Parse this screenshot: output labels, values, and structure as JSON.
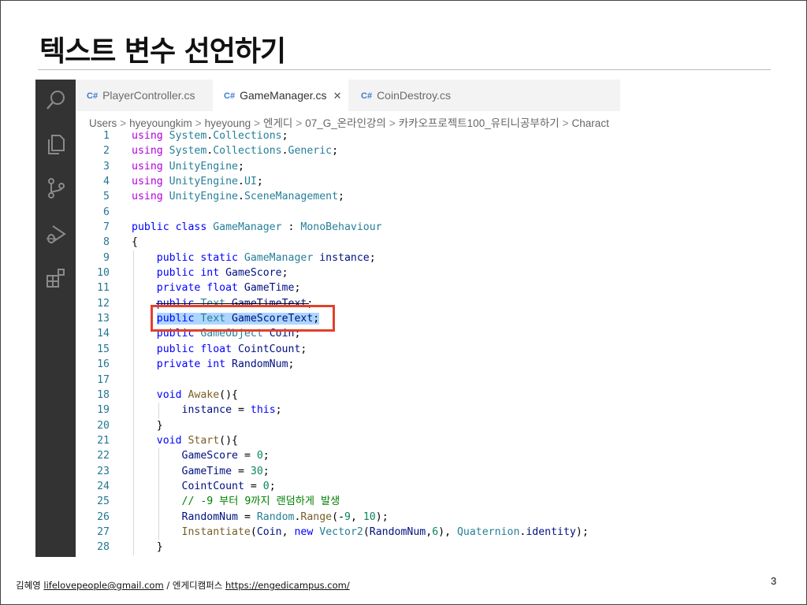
{
  "slide": {
    "title": "텍스트 변수 선언하기",
    "page_number": "3"
  },
  "footer": {
    "author": "김혜영",
    "email": "lifelovepeople@gmail.com",
    "separator": "/",
    "org": "엔게디캠퍼스",
    "url": "https://engedicampus.com/"
  },
  "activity_bar": {
    "icons": [
      "search-icon",
      "files-icon",
      "source-control-icon",
      "run-debug-icon",
      "extensions-icon"
    ]
  },
  "tabs": [
    {
      "icon": "C#",
      "label": "PlayerController.cs",
      "active": false
    },
    {
      "icon": "C#",
      "label": "GameManager.cs",
      "active": true,
      "close": "✕"
    },
    {
      "icon": "C#",
      "label": "CoinDestroy.cs",
      "active": false
    }
  ],
  "breadcrumb": [
    "Users",
    "hyeyoungkim",
    "hyeyoung",
    "엔게디",
    "07_G_온라인강의",
    "카카오프로젝트100_유티니공부하기",
    "Charact"
  ],
  "breadcrumb_sep": ">",
  "code_lines": [
    [
      [
        "kwp",
        "using "
      ],
      [
        "ty",
        "System"
      ],
      [
        "pn",
        "."
      ],
      [
        "ty",
        "Collections"
      ],
      [
        "pn",
        ";"
      ]
    ],
    [
      [
        "kwp",
        "using "
      ],
      [
        "ty",
        "System"
      ],
      [
        "pn",
        "."
      ],
      [
        "ty",
        "Collections"
      ],
      [
        "pn",
        "."
      ],
      [
        "ty",
        "Generic"
      ],
      [
        "pn",
        ";"
      ]
    ],
    [
      [
        "kwp",
        "using "
      ],
      [
        "ty",
        "UnityEngine"
      ],
      [
        "pn",
        ";"
      ]
    ],
    [
      [
        "kwp",
        "using "
      ],
      [
        "ty",
        "UnityEngine"
      ],
      [
        "pn",
        "."
      ],
      [
        "ty",
        "UI"
      ],
      [
        "pn",
        ";"
      ]
    ],
    [
      [
        "kwp",
        "using "
      ],
      [
        "ty",
        "UnityEngine"
      ],
      [
        "pn",
        "."
      ],
      [
        "ty",
        "SceneManagement"
      ],
      [
        "pn",
        ";"
      ]
    ],
    [],
    [
      [
        "kw",
        "public class "
      ],
      [
        "ty",
        "GameManager"
      ],
      [
        "pn",
        " : "
      ],
      [
        "ty",
        "MonoBehaviour"
      ]
    ],
    [
      [
        "pn",
        "{"
      ]
    ],
    [
      [
        "pn",
        "    "
      ],
      [
        "kw",
        "public static "
      ],
      [
        "ty",
        "GameManager "
      ],
      [
        "id",
        "instance"
      ],
      [
        "pn",
        ";"
      ]
    ],
    [
      [
        "pn",
        "    "
      ],
      [
        "kw",
        "public int "
      ],
      [
        "id",
        "GameScore"
      ],
      [
        "pn",
        ";"
      ]
    ],
    [
      [
        "pn",
        "    "
      ],
      [
        "kw",
        "private float "
      ],
      [
        "id",
        "GameTime"
      ],
      [
        "pn",
        ";"
      ]
    ],
    [
      [
        "pn",
        "    "
      ],
      [
        "kw",
        "public "
      ],
      [
        "ty",
        "Text "
      ],
      [
        "id",
        "GameTimeText"
      ],
      [
        "pn",
        ";"
      ]
    ],
    [
      [
        "pn",
        "    "
      ],
      [
        "kw",
        "public "
      ],
      [
        "ty",
        "Text "
      ],
      [
        "id",
        "GameScoreText"
      ],
      [
        "pn",
        ";"
      ]
    ],
    [
      [
        "pn",
        "    "
      ],
      [
        "kw",
        "public "
      ],
      [
        "ty",
        "GameObject "
      ],
      [
        "id",
        "Coin"
      ],
      [
        "pn",
        ";"
      ]
    ],
    [
      [
        "pn",
        "    "
      ],
      [
        "kw",
        "public float "
      ],
      [
        "id",
        "CointCount"
      ],
      [
        "pn",
        ";"
      ]
    ],
    [
      [
        "pn",
        "    "
      ],
      [
        "kw",
        "private int "
      ],
      [
        "id",
        "RandomNum"
      ],
      [
        "pn",
        ";"
      ]
    ],
    [],
    [
      [
        "pn",
        "    "
      ],
      [
        "kw",
        "void "
      ],
      [
        "fn",
        "Awake"
      ],
      [
        "pn",
        "(){"
      ]
    ],
    [
      [
        "pn",
        "        "
      ],
      [
        "id",
        "instance"
      ],
      [
        "pn",
        " = "
      ],
      [
        "kw",
        "this"
      ],
      [
        "pn",
        ";"
      ]
    ],
    [
      [
        "pn",
        "    }"
      ]
    ],
    [
      [
        "pn",
        "    "
      ],
      [
        "kw",
        "void "
      ],
      [
        "fn",
        "Start"
      ],
      [
        "pn",
        "(){"
      ]
    ],
    [
      [
        "pn",
        "        "
      ],
      [
        "id",
        "GameScore"
      ],
      [
        "pn",
        " = "
      ],
      [
        "nm",
        "0"
      ],
      [
        "pn",
        ";"
      ]
    ],
    [
      [
        "pn",
        "        "
      ],
      [
        "id",
        "GameTime"
      ],
      [
        "pn",
        " = "
      ],
      [
        "nm",
        "30"
      ],
      [
        "pn",
        ";"
      ]
    ],
    [
      [
        "pn",
        "        "
      ],
      [
        "id",
        "CointCount"
      ],
      [
        "pn",
        " = "
      ],
      [
        "nm",
        "0"
      ],
      [
        "pn",
        ";"
      ]
    ],
    [
      [
        "pn",
        "        "
      ],
      [
        "cm",
        "// -9 부터 9까지 랜덤하게 발생"
      ]
    ],
    [
      [
        "pn",
        "        "
      ],
      [
        "id",
        "RandomNum"
      ],
      [
        "pn",
        " = "
      ],
      [
        "ty",
        "Random"
      ],
      [
        "pn",
        "."
      ],
      [
        "fn",
        "Range"
      ],
      [
        "pn",
        "(-"
      ],
      [
        "nm",
        "9"
      ],
      [
        "pn",
        ", "
      ],
      [
        "nm",
        "10"
      ],
      [
        "pn",
        ");"
      ]
    ],
    [
      [
        "pn",
        "        "
      ],
      [
        "fn",
        "Instantiate"
      ],
      [
        "pn",
        "("
      ],
      [
        "id",
        "Coin"
      ],
      [
        "pn",
        ", "
      ],
      [
        "kw",
        "new "
      ],
      [
        "ty",
        "Vector2"
      ],
      [
        "pn",
        "("
      ],
      [
        "id",
        "RandomNum"
      ],
      [
        "pn",
        ","
      ],
      [
        "nm",
        "6"
      ],
      [
        "pn",
        "), "
      ],
      [
        "ty",
        "Quaternion"
      ],
      [
        "pn",
        "."
      ],
      [
        "id",
        "identity"
      ],
      [
        "pn",
        ");"
      ]
    ],
    [
      [
        "pn",
        "    }"
      ]
    ]
  ],
  "line_numbers": [
    "1",
    "2",
    "3",
    "4",
    "5",
    "6",
    "7",
    "8",
    "9",
    "10",
    "11",
    "12",
    "13",
    "14",
    "15",
    "16",
    "17",
    "18",
    "19",
    "20",
    "21",
    "22",
    "23",
    "24",
    "25",
    "26",
    "27",
    "28"
  ],
  "highlighted_line": 13,
  "struck_line": 12,
  "colors": {
    "activity_bar": "#333333",
    "highlight_box": "#e2412b",
    "selection": "#add6ff",
    "keyword": "#0000ff",
    "type": "#267f99"
  }
}
